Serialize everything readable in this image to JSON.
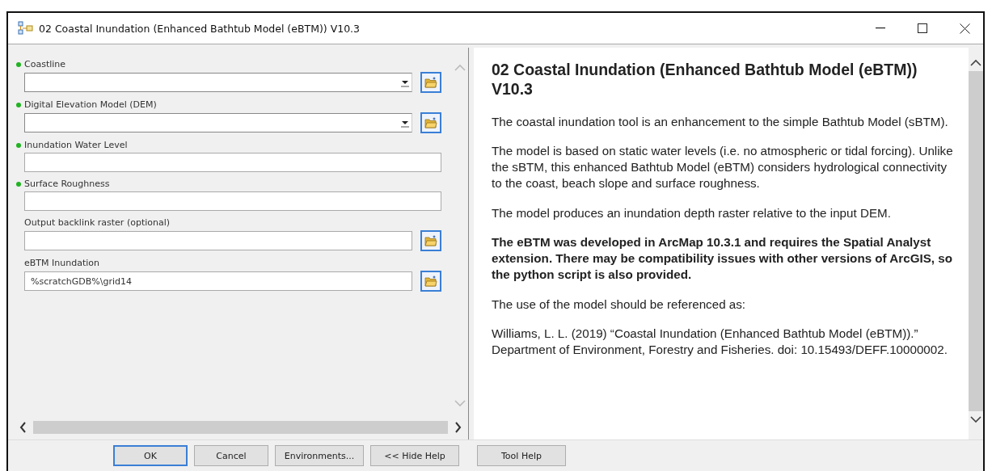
{
  "window": {
    "title": "02 Coastal Inundation (Enhanced Bathtub Model (eBTM)) V10.3"
  },
  "parameters": [
    {
      "label": "Coastline",
      "required": true,
      "kind": "combo"
    },
    {
      "label": "Digital Elevation Model (DEM)",
      "required": true,
      "kind": "combo"
    },
    {
      "label": "Inundation Water Level",
      "required": true,
      "kind": "text"
    },
    {
      "label": "Surface Roughness",
      "required": true,
      "kind": "text"
    },
    {
      "label": "Output backlink raster (optional)",
      "required": false,
      "kind": "browse"
    },
    {
      "label": "eBTM Inundation",
      "required": false,
      "kind": "browse",
      "value": "%scratchGDB%\\grid14"
    }
  ],
  "help": {
    "heading": "02 Coastal Inundation (Enhanced Bathtub Model (eBTM)) V10.3",
    "paragraphs": [
      {
        "text": "The coastal inundation tool is an enhancement to the simple Bathtub Model (sBTM).",
        "bold": false
      },
      {
        "text": "The model is based on static water levels (i.e. no atmospheric or tidal forcing). Unlike the sBTM, this enhanced Bathtub Model (eBTM) considers hydrological connectivity to the coast, beach slope and surface roughness.",
        "bold": false
      },
      {
        "text": "The model produces an inundation depth raster relative to the input DEM.",
        "bold": false
      },
      {
        "text": "The eBTM was developed in ArcMap 10.3.1 and requires the Spatial Analyst extension. There may be compatibility issues with other versions of ArcGIS, so the python script is also provided.",
        "bold": true
      },
      {
        "text": "The use of the model should be referenced as:",
        "bold": false
      },
      {
        "text": "Williams, L. L. (2019) “Coastal Inundation (Enhanced Bathtub Model (eBTM)).” Department of Environment, Forestry and Fisheries. doi: 10.15493/DEFF.10000002.",
        "bold": false
      }
    ]
  },
  "buttons": [
    {
      "label": "OK",
      "selected": true
    },
    {
      "label": "Cancel",
      "selected": false
    },
    {
      "label": "Environments...",
      "selected": false
    },
    {
      "label": "<< Hide Help",
      "selected": false
    },
    {
      "label": "Tool Help",
      "selected": false
    }
  ]
}
